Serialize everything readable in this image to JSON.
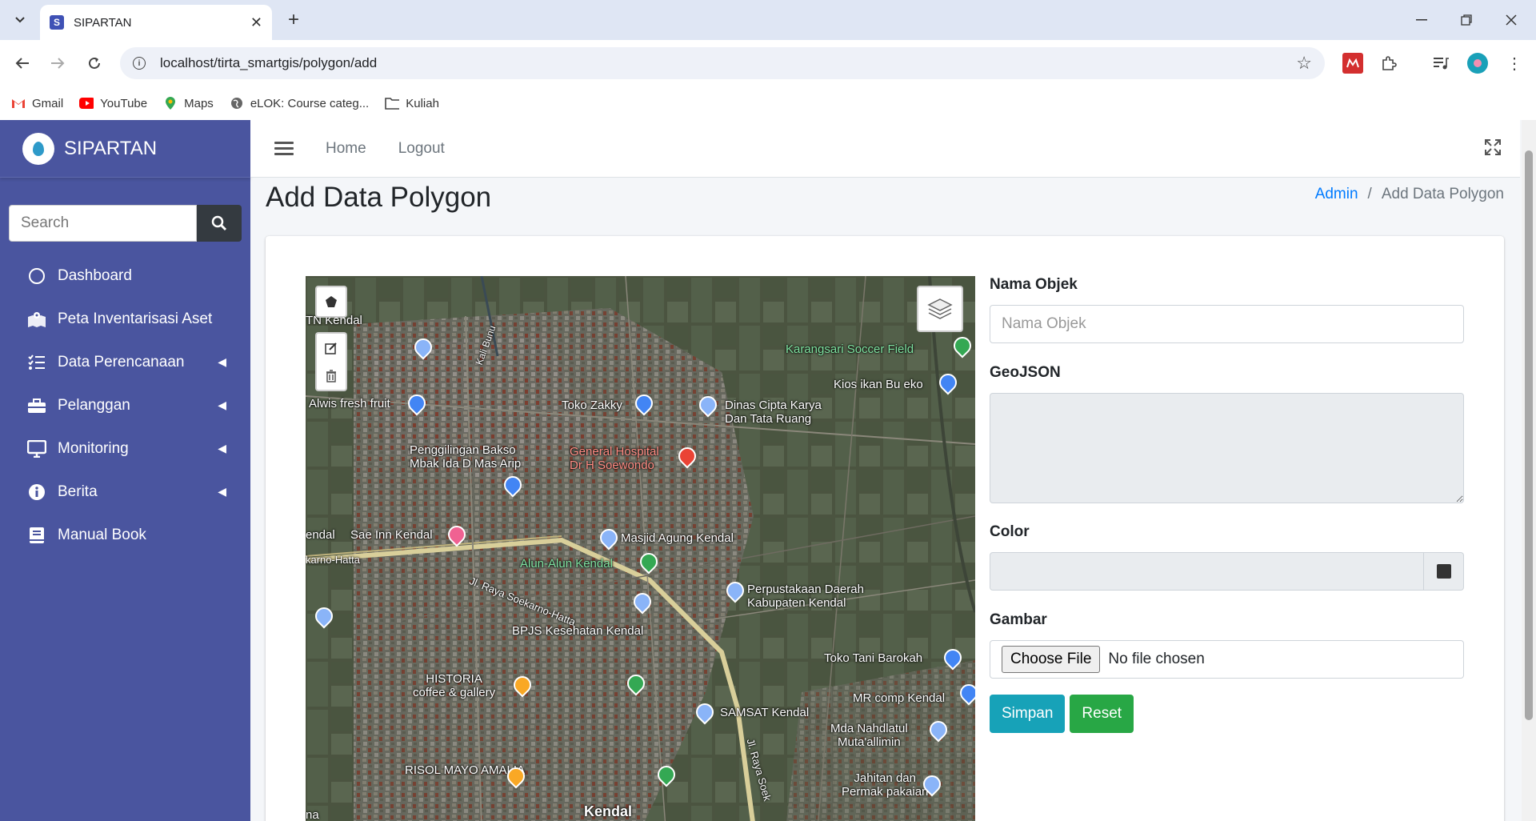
{
  "browser": {
    "tab_title": "SIPARTAN",
    "tab_favicon_letter": "S",
    "url": "localhost/tirta_smartgis/polygon/add",
    "bookmarks": [
      {
        "label": "Gmail",
        "icon": "gmail-icon"
      },
      {
        "label": "YouTube",
        "icon": "youtube-icon"
      },
      {
        "label": "Maps",
        "icon": "maps-icon"
      },
      {
        "label": "eLOK: Course categ...",
        "icon": "globe-icon"
      },
      {
        "label": "Kuliah",
        "icon": "folder-icon"
      }
    ]
  },
  "sidebar": {
    "brand": "SIPARTAN",
    "search_placeholder": "Search",
    "items": [
      {
        "label": "Dashboard",
        "icon": "circle-icon",
        "has_arrow": false
      },
      {
        "label": "Peta Inventarisasi Aset",
        "icon": "map-marked-icon",
        "has_arrow": false
      },
      {
        "label": "Data Perencanaan",
        "icon": "list-check-icon",
        "has_arrow": true
      },
      {
        "label": "Pelanggan",
        "icon": "toolbox-icon",
        "has_arrow": true
      },
      {
        "label": "Monitoring",
        "icon": "desktop-icon",
        "has_arrow": true
      },
      {
        "label": "Berita",
        "icon": "info-circle-icon",
        "has_arrow": true
      },
      {
        "label": "Manual Book",
        "icon": "book-icon",
        "has_arrow": false
      }
    ]
  },
  "header": {
    "links": [
      "Home",
      "Logout"
    ]
  },
  "content": {
    "title": "Add Data Polygon",
    "breadcrumb": {
      "parent": "Admin",
      "current": "Add Data Polygon"
    }
  },
  "map": {
    "labels": [
      {
        "text": "TN Kendal",
        "style": ""
      },
      {
        "text": "Kali Bunu",
        "style": ""
      },
      {
        "text": "Karangsari Soccer Field",
        "style": "green"
      },
      {
        "text": "Kios ikan Bu eko",
        "style": ""
      },
      {
        "text": "Alwis fresh fruit",
        "style": ""
      },
      {
        "text": "Toko Zakky",
        "style": ""
      },
      {
        "text": "Dinas Cipta Karya\nDan Tata Ruang",
        "style": ""
      },
      {
        "text": "Penggilingan Bakso\nMbak Ida D Mas Arip",
        "style": ""
      },
      {
        "text": "General Hospital\nDr H Soewondo",
        "style": "red"
      },
      {
        "text": "endal",
        "style": ""
      },
      {
        "text": "Sae Inn Kendal",
        "style": ""
      },
      {
        "text": "Masjid Agung Kendal",
        "style": ""
      },
      {
        "text": "karno-Hatta",
        "style": ""
      },
      {
        "text": "Alun-Alun Kendal",
        "style": "green"
      },
      {
        "text": "Jl. Raya Soekarno-Hatta",
        "style": ""
      },
      {
        "text": "Perpustakaan Daerah\nKabupaten Kendal",
        "style": ""
      },
      {
        "text": "BPJS Kesehatan Kendal",
        "style": ""
      },
      {
        "text": "Toko Tani Barokah",
        "style": ""
      },
      {
        "text": "HISTORIA\ncoffee & gallery",
        "style": ""
      },
      {
        "text": "MR comp Kendal",
        "style": ""
      },
      {
        "text": "SAMSAT Kendal",
        "style": ""
      },
      {
        "text": "Mda Nahdlatul\nMuta'allimin",
        "style": ""
      },
      {
        "text": "Jl. Raya Soek",
        "style": ""
      },
      {
        "text": "RISOL MAYO AMALIA",
        "style": ""
      },
      {
        "text": "Jahitan dan\nPermak pakaian",
        "style": ""
      },
      {
        "text": "Kendal",
        "style": "big"
      },
      {
        "text": "na",
        "style": ""
      }
    ]
  },
  "form": {
    "nama_label": "Nama Objek",
    "nama_placeholder": "Nama Objek",
    "geojson_label": "GeoJSON",
    "color_label": "Color",
    "gambar_label": "Gambar",
    "file_button": "Choose File",
    "file_status": "No file chosen",
    "save_label": "Simpan",
    "reset_label": "Reset"
  },
  "colors": {
    "sidebar": "#4a559f",
    "primary_button": "#17a2b8",
    "success_button": "#28a745",
    "link": "#007bff"
  }
}
